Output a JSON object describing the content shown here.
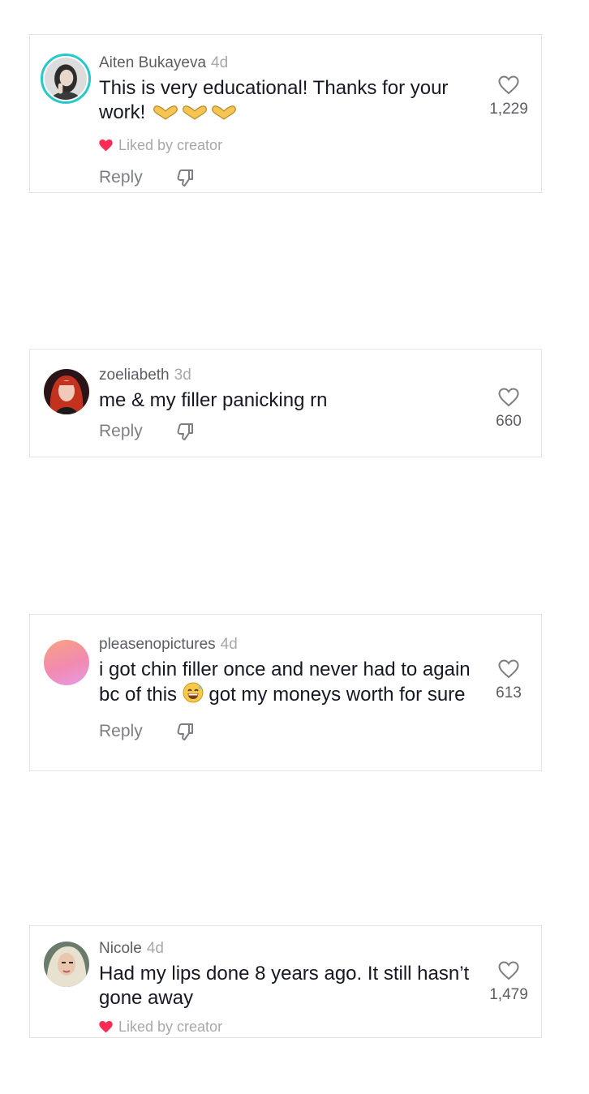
{
  "colors": {
    "liked_heart": "#fe2c55",
    "avatar_ring": "#25c9c8",
    "border": "#e3e3e4",
    "muted_text": "#a7a8ac"
  },
  "comments": [
    {
      "username": "Aiten Bukayeva",
      "time": "4d",
      "text_before_emoji": "This is very educational! Thanks for your work!",
      "emoji_names": [
        "heart-hands-emoji",
        "heart-hands-emoji",
        "heart-hands-emoji"
      ],
      "liked_by_creator": "Liked by creator",
      "reply_label": "Reply",
      "like_count": "1,229"
    },
    {
      "username": "zoeliabeth",
      "time": "3d",
      "text": "me & my filler panicking rn",
      "reply_label": "Reply",
      "like_count": "660"
    },
    {
      "username": "pleasenopictures",
      "time": "4d",
      "text_before_emoji": "i got chin filler once and never had to again bc of this",
      "emoji_name": "grinning-sweat-emoji",
      "text_after_emoji": "got my moneys worth for sure",
      "reply_label": "Reply",
      "like_count": "613"
    },
    {
      "username": "Nicole",
      "time": "4d",
      "text": "Had my lips done 8 years ago. It still hasn’t gone away",
      "liked_by_creator": "Liked by creator",
      "like_count": "1,479"
    }
  ]
}
